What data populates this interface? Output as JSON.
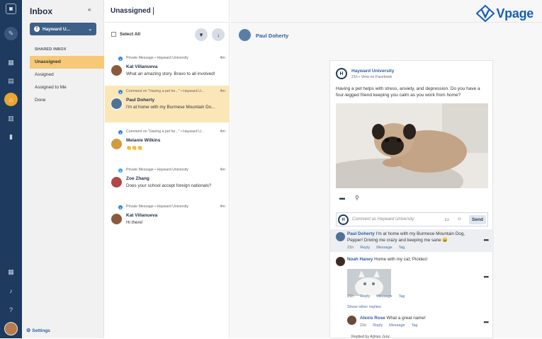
{
  "rail": {
    "icons": [
      "logo-icon",
      "compose-icon",
      "dashboard-icon",
      "calendar-icon",
      "inbox-icon",
      "tasks-icon",
      "reports-icon",
      "apps-icon",
      "notifications-icon",
      "help-icon"
    ]
  },
  "sidebar": {
    "title": "Inbox",
    "collapse": "«",
    "account": "Hayward U...",
    "section": "SHARED INBOX",
    "items": [
      "Unassigned",
      "Assigned",
      "Assigned to Me",
      "Done"
    ],
    "settings": "Settings"
  },
  "list": {
    "title": "Unassigned",
    "select_all": "Select All",
    "conversations": [
      {
        "source": "Private Message • Hayward University",
        "time": "4m",
        "name": "Kat Villanueva",
        "message": "What an amazing story. Bravo to all involved!",
        "channel": "facebook"
      },
      {
        "source": "Comment on \"Having a pet he...\" • Hayward U...",
        "time": "4m",
        "name": "Paul Doherty",
        "message": "I'm at home with my Burmese Mountain Do...",
        "channel": "facebook"
      },
      {
        "source": "Comment on \"Having a pet he...\" • Hayward U...",
        "time": "4m",
        "name": "Melanie Wilkins",
        "message": "👏👏👏",
        "channel": "facebook"
      },
      {
        "source": "Private Message • Hayward University",
        "time": "4m",
        "name": "Zoe Zhang",
        "message": "Does your school accept foreign nationals?",
        "channel": "twitter"
      },
      {
        "source": "Private Message • Hayward University",
        "time": "4m",
        "name": "Kat Villanueva",
        "message": "Hi there!",
        "channel": "facebook"
      }
    ]
  },
  "detail": {
    "contact": "Paul Doherty",
    "brand": "Vpage",
    "post": {
      "page": "Hayward University",
      "meta": "21h • View on Facebook",
      "body": "Having a pet helps with stress, anxiety, and depression. Do you have a four-legged friend keeping you calm as you work from home?"
    },
    "comment_box": {
      "placeholder": "Comment as Hayward University",
      "send": "Send"
    },
    "comments": [
      {
        "name": "Paul Doherty",
        "text": "I'm at home with my Burmese Mountain Dog, Pepper! Driving me crazy and keeping me sane 😄",
        "time": "21h",
        "reply": "Reply",
        "message": "Message",
        "tag": "Tag"
      },
      {
        "name": "Noah Haney",
        "text": "Home with my cat, Pickles!",
        "time": "21h",
        "reply": "Reply",
        "message": "Message",
        "tag": "Tag"
      },
      {
        "name": "Alexis Rose",
        "text": "What a great name!",
        "time": "21h",
        "reply": "Reply",
        "message": "Message",
        "tag": "Tag"
      }
    ],
    "show_more": "Show other replies",
    "replied_by": "Replied by Adrian Junz"
  }
}
